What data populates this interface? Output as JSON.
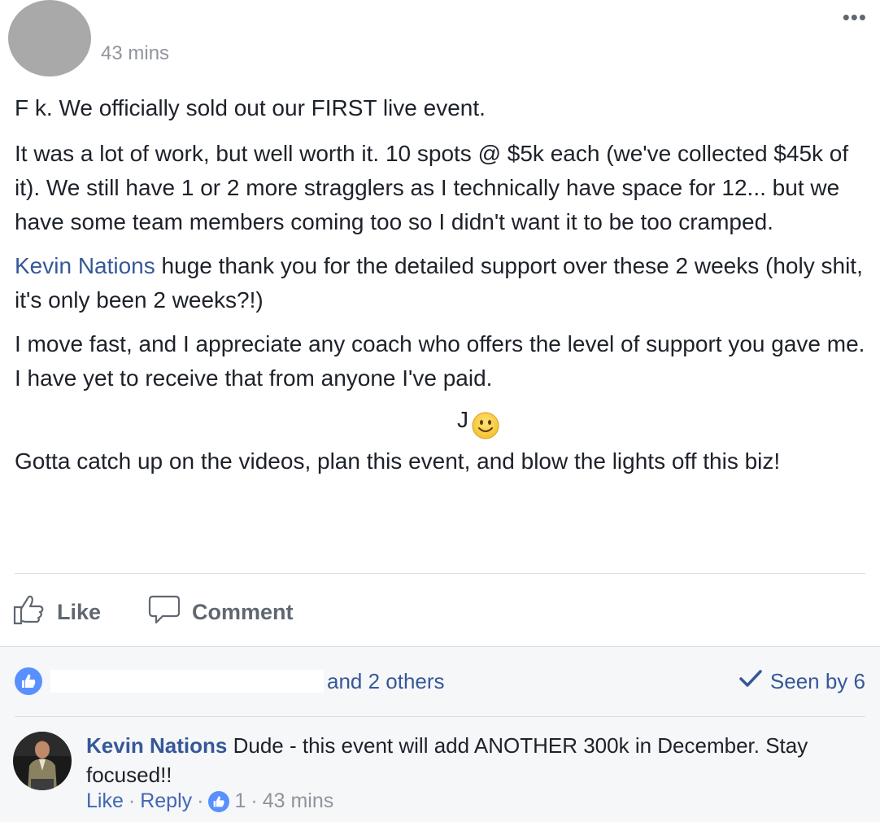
{
  "post": {
    "timestamp": "43 mins",
    "more_label": "•••",
    "line1": "F k. We officially sold out our FIRST live event.",
    "line2": "It was a lot of work, but well worth it. 10 spots @ $5k each (we've collected $45k of it). We still have 1 or 2 more stragglers as I technically have space for 12... but we have some team members coming too so I didn't want it to be too cramped.",
    "mention": "Kevin Nations",
    "line3_rest": " huge thank you for the detailed support over these 2 weeks (holy shit, it's only been 2 weeks?!)",
    "line4": "I move fast, and I appreciate any coach who offers the level of support you gave me. I have yet to receive that from anyone I've paid.",
    "j_char": "J",
    "line5": "Gotta catch up on the videos, plan this event, and blow the lights off this biz!"
  },
  "actions": {
    "like_label": "Like",
    "comment_label": "Comment"
  },
  "reactions": {
    "others_label": "and 2 others",
    "seen_label": "Seen by 6"
  },
  "comment": {
    "author": "Kevin Nations",
    "text": " Dude - this event will add ANOTHER 300k in December. Stay focused!!",
    "like_label": "Like",
    "reply_label": "Reply",
    "like_count": "1",
    "time": "43 mins",
    "dot": "·"
  },
  "colors": {
    "link": "#365899",
    "muted": "#90949c",
    "like_blue": "#5890ff"
  }
}
